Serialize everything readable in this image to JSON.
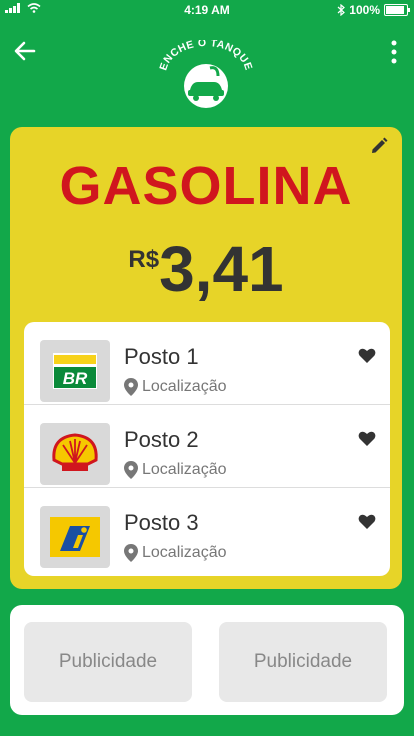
{
  "status_bar": {
    "time": "4:19 AM",
    "battery": "100%"
  },
  "header": {
    "logo_text": "ENCHE O TANQUE"
  },
  "fuel": {
    "name": "GASOLINA",
    "currency": "R$",
    "price": "3,41"
  },
  "stations": [
    {
      "name": "Posto 1",
      "location": "Localização",
      "brand": "BR"
    },
    {
      "name": "Posto 2",
      "location": "Localização",
      "brand": "shell"
    },
    {
      "name": "Posto 3",
      "location": "Localização",
      "brand": "ipiranga"
    }
  ],
  "ads": [
    "Publicidade",
    "Publicidade"
  ],
  "colors": {
    "background": "#12a84a",
    "card": "#e7d428",
    "title": "#d0161e"
  }
}
